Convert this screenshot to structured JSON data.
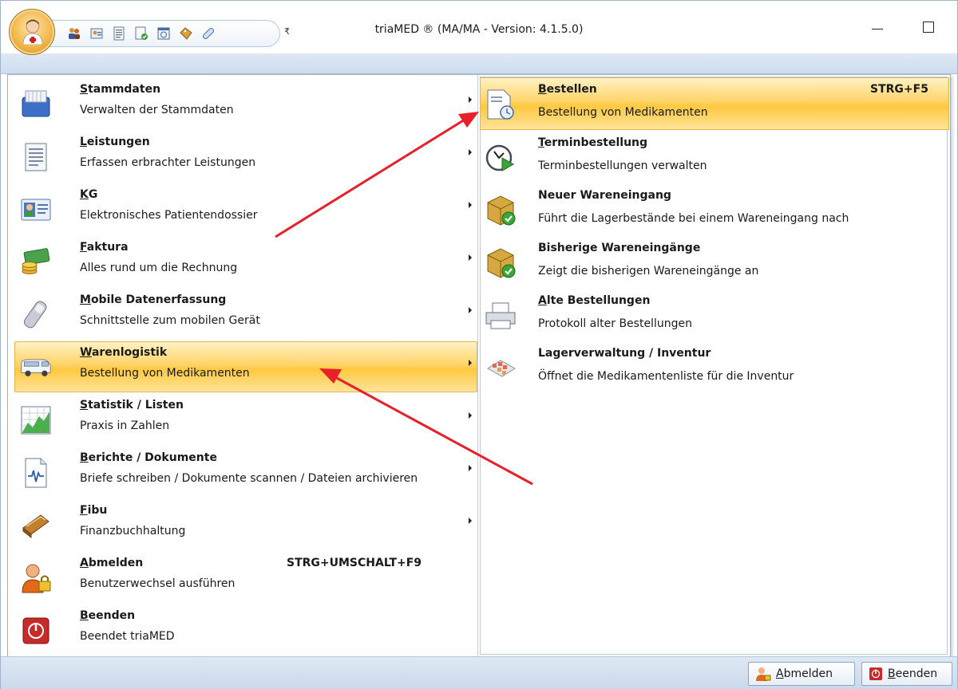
{
  "window": {
    "title": "triaMED ® (MA/MA - Version: 4.1.5.0)",
    "qat_dropdown_glyph": "₹"
  },
  "qat": {
    "items": [
      {
        "icon": "patients-icon"
      },
      {
        "icon": "address-book-icon"
      },
      {
        "icon": "document-list-icon"
      },
      {
        "icon": "checklist-icon"
      },
      {
        "icon": "calendar-icon"
      },
      {
        "icon": "tag-icon"
      },
      {
        "icon": "pill-icon"
      }
    ]
  },
  "main_menu": {
    "items": [
      {
        "title_mn": "S",
        "title_rest": "tammdaten",
        "desc": "Verwalten der Stammdaten",
        "icon": "drawer-cards-icon"
      },
      {
        "title_mn": "L",
        "title_rest": "eistungen",
        "desc": "Erfassen erbrachter Leistungen",
        "icon": "document-list-icon"
      },
      {
        "title_mn": "K",
        "title_rest": "G",
        "desc": "Elektronisches Patientendossier",
        "icon": "patient-card-icon"
      },
      {
        "title_mn": "F",
        "title_rest": "aktura",
        "desc": "Alles rund um die Rechnung",
        "icon": "money-icon"
      },
      {
        "title_mn": "M",
        "title_rest": "obile Datenerfassung",
        "desc": "Schnittstelle zum mobilen Gerät",
        "icon": "usb-stick-icon"
      },
      {
        "title_mn": "W",
        "title_rest": "arenlogistik",
        "desc": "Bestellung von Medikamenten",
        "icon": "delivery-van-icon"
      },
      {
        "title_mn": "S",
        "title_rest": "tatistik / Listen",
        "desc": "Praxis in Zahlen",
        "icon": "chart-icon"
      },
      {
        "title_mn": "B",
        "title_rest": "erichte / Dokumente",
        "desc": "Briefe schreiben / Dokumente scannen / Dateien archivieren",
        "icon": "report-icon"
      },
      {
        "title_mn": "F",
        "title_rest": "ibu",
        "desc": "Finanzbuchhaltung",
        "icon": "accounting-icon"
      },
      {
        "title_mn": "A",
        "title_rest": "bmelden",
        "desc": "Benutzerwechsel ausführen",
        "shortcut": "STRG+UMSCHALT+F9",
        "icon": "user-lock-icon"
      },
      {
        "title_mn": "B",
        "title_rest": "eenden",
        "desc": "Beendet triaMED",
        "icon": "power-icon"
      }
    ]
  },
  "submenu": {
    "items": [
      {
        "title_mn": "B",
        "title_rest": "estellen",
        "desc": "Bestellung von Medikamenten",
        "shortcut": "STRG+F5",
        "icon": "order-document-icon"
      },
      {
        "title_mn": "T",
        "title_rest": "erminbestellung",
        "desc": "Terminbestellungen verwalten",
        "icon": "clock-play-icon"
      },
      {
        "title_mn": "",
        "title_rest": "Neuer Wareneingang",
        "desc": "Führt die Lagerbestände bei einem Wareneingang nach",
        "icon": "box-check-icon"
      },
      {
        "title_mn": "",
        "title_rest": "Bisherige Wareneingänge",
        "desc": "Zeigt die bisherigen Wareneingänge an",
        "icon": "box-check-icon"
      },
      {
        "title_mn": "A",
        "title_rest": "lte Bestellungen",
        "desc": "Protokoll alter Bestellungen",
        "icon": "printer-icon"
      },
      {
        "title_mn": "",
        "title_rest": "Lagerverwaltung / Inventur",
        "desc": "Öffnet die Medikamentenliste für die Inventur",
        "icon": "medicine-shelf-icon"
      }
    ]
  },
  "statusbar": {
    "logout_mn": "A",
    "logout_rest": "bmelden",
    "exit_mn": "B",
    "exit_rest": "eenden"
  },
  "colors": {
    "highlight": "#ffd46a",
    "annotation_arrow": "#e8202a"
  }
}
